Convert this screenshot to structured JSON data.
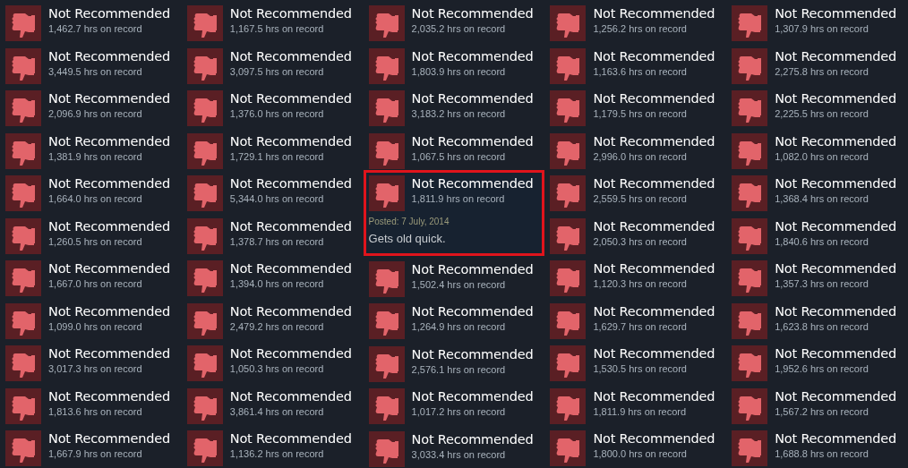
{
  "columns": [
    {
      "reviews": [
        {
          "title": "Not Recommended",
          "hours": "1,462.7 hrs on record",
          "highlighted": false
        },
        {
          "title": "Not Recommended",
          "hours": "3,449.5 hrs on record",
          "highlighted": false
        },
        {
          "title": "Not Recommended",
          "hours": "2,096.9 hrs on record",
          "highlighted": false
        },
        {
          "title": "Not Recommended",
          "hours": "1,381.9 hrs on record",
          "highlighted": false
        },
        {
          "title": "Not Recommended",
          "hours": "1,664.0 hrs on record",
          "highlighted": false
        },
        {
          "title": "Not Recommended",
          "hours": "1,260.5 hrs on record",
          "highlighted": false
        },
        {
          "title": "Not Recommended",
          "hours": "1,667.0 hrs on record",
          "highlighted": false
        },
        {
          "title": "Not Recommended",
          "hours": "1,099.0 hrs on record",
          "highlighted": false
        },
        {
          "title": "Not Recommended",
          "hours": "3,017.3 hrs on record",
          "highlighted": false
        },
        {
          "title": "Not Recommended",
          "hours": "1,813.6 hrs on record",
          "highlighted": false
        },
        {
          "title": "Not Recommended",
          "hours": "1,667.9 hrs on record",
          "highlighted": false
        }
      ]
    },
    {
      "reviews": [
        {
          "title": "Not Recommended",
          "hours": "1,167.5 hrs on record",
          "highlighted": false
        },
        {
          "title": "Not Recommended",
          "hours": "3,097.5 hrs on record",
          "highlighted": false
        },
        {
          "title": "Not Recommended",
          "hours": "1,376.0 hrs on record",
          "highlighted": false
        },
        {
          "title": "Not Recommended",
          "hours": "1,729.1 hrs on record",
          "highlighted": false
        },
        {
          "title": "Not Recommended",
          "hours": "5,344.0 hrs on record",
          "highlighted": false
        },
        {
          "title": "Not Recommended",
          "hours": "1,378.7 hrs on record",
          "highlighted": false
        },
        {
          "title": "Not Recommended",
          "hours": "1,394.0 hrs on record",
          "highlighted": false
        },
        {
          "title": "Not Recommended",
          "hours": "2,479.2 hrs on record",
          "highlighted": false
        },
        {
          "title": "Not Recommended",
          "hours": "1,050.3 hrs on record",
          "highlighted": false
        },
        {
          "title": "Not Recommended",
          "hours": "3,861.4 hrs on record",
          "highlighted": false
        },
        {
          "title": "Not Recommended",
          "hours": "1,136.2 hrs on record",
          "highlighted": false
        }
      ]
    },
    {
      "reviews": [
        {
          "title": "Not Recommended",
          "hours": "2,035.2 hrs on record",
          "highlighted": false
        },
        {
          "title": "Not Recommended",
          "hours": "1,803.9 hrs on record",
          "highlighted": false
        },
        {
          "title": "Not Recommended",
          "hours": "3,183.2 hrs on record",
          "highlighted": false
        },
        {
          "title": "Not Recommended",
          "hours": "1,067.5 hrs on record",
          "highlighted": false
        },
        {
          "title": "Not Recommended",
          "hours": "1,811.9 hrs on record",
          "highlighted": true,
          "posted": "Posted: 7 July, 2014",
          "text": "Gets old quick."
        },
        {
          "title": "Not Recommended",
          "hours": "1,502.4 hrs on record",
          "highlighted": false
        },
        {
          "title": "Not Recommended",
          "hours": "1,264.9 hrs on record",
          "highlighted": false
        },
        {
          "title": "Not Recommended",
          "hours": "2,576.1 hrs on record",
          "highlighted": false
        },
        {
          "title": "Not Recommended",
          "hours": "1,017.2 hrs on record",
          "highlighted": false
        },
        {
          "title": "Not Recommended",
          "hours": "3,033.4 hrs on record",
          "highlighted": false
        }
      ]
    },
    {
      "reviews": [
        {
          "title": "Not Recommended",
          "hours": "1,256.2 hrs on record",
          "highlighted": false
        },
        {
          "title": "Not Recommended",
          "hours": "1,163.6 hrs on record",
          "highlighted": false
        },
        {
          "title": "Not Recommended",
          "hours": "1,179.5 hrs on record",
          "highlighted": false
        },
        {
          "title": "Not Recommended",
          "hours": "2,996.0 hrs on record",
          "highlighted": false
        },
        {
          "title": "Not Recommended",
          "hours": "2,559.5 hrs on record",
          "highlighted": false
        },
        {
          "title": "Not Recommended",
          "hours": "2,050.3 hrs on record",
          "highlighted": false
        },
        {
          "title": "Not Recommended",
          "hours": "1,120.3 hrs on record",
          "highlighted": false
        },
        {
          "title": "Not Recommended",
          "hours": "1,629.7 hrs on record",
          "highlighted": false
        },
        {
          "title": "Not Recommended",
          "hours": "1,530.5 hrs on record",
          "highlighted": false
        },
        {
          "title": "Not Recommended",
          "hours": "1,811.9 hrs on record",
          "highlighted": false
        },
        {
          "title": "Not Recommended",
          "hours": "1,800.0 hrs on record",
          "highlighted": false
        }
      ]
    },
    {
      "reviews": [
        {
          "title": "Not Recommended",
          "hours": "1,307.9 hrs on record",
          "highlighted": false
        },
        {
          "title": "Not Recommended",
          "hours": "2,275.8 hrs on record",
          "highlighted": false
        },
        {
          "title": "Not Recommended",
          "hours": "2,225.5 hrs on record",
          "highlighted": false
        },
        {
          "title": "Not Recommended",
          "hours": "1,082.0 hrs on record",
          "highlighted": false
        },
        {
          "title": "Not Recommended",
          "hours": "1,368.4 hrs on record",
          "highlighted": false
        },
        {
          "title": "Not Recommended",
          "hours": "1,840.6 hrs on record",
          "highlighted": false
        },
        {
          "title": "Not Recommended",
          "hours": "1,357.3 hrs on record",
          "highlighted": false
        },
        {
          "title": "Not Recommended",
          "hours": "1,623.8 hrs on record",
          "highlighted": false
        },
        {
          "title": "Not Recommended",
          "hours": "1,952.6 hrs on record",
          "highlighted": false
        },
        {
          "title": "Not Recommended",
          "hours": "1,567.2 hrs on record",
          "highlighted": false
        },
        {
          "title": "Not Recommended",
          "hours": "1,688.8 hrs on record",
          "highlighted": false
        }
      ]
    }
  ]
}
